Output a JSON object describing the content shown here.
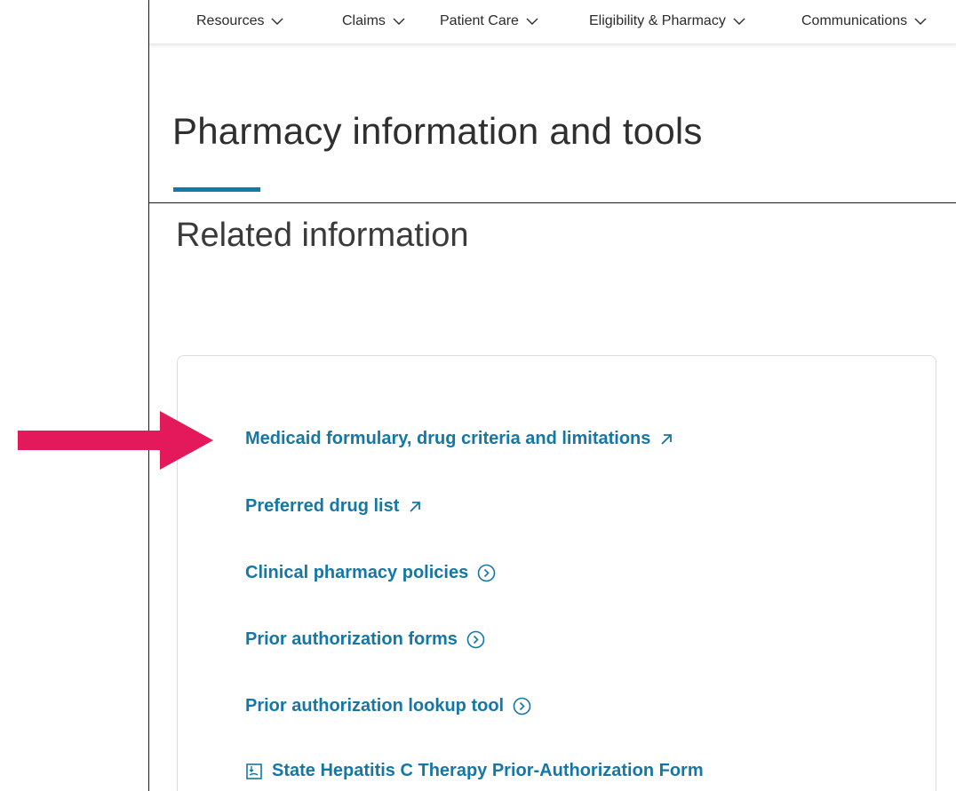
{
  "nav": {
    "items": [
      {
        "label": "Resources"
      },
      {
        "label": "Claims"
      },
      {
        "label": "Patient Care"
      },
      {
        "label": "Eligibility & Pharmacy"
      },
      {
        "label": "Communications"
      }
    ]
  },
  "page": {
    "title": "Pharmacy information and tools"
  },
  "related": {
    "heading": "Related information",
    "links": [
      {
        "label": "Medicaid formulary, drug criteria and limitations",
        "icon": "external-link-icon"
      },
      {
        "label": "Preferred drug list",
        "icon": "external-link-icon"
      },
      {
        "label": "Clinical pharmacy policies",
        "icon": "chevron-circle-right-icon"
      },
      {
        "label": "Prior authorization forms",
        "icon": "chevron-circle-right-icon"
      },
      {
        "label": "Prior authorization lookup tool",
        "icon": "chevron-circle-right-icon"
      },
      {
        "label": "State Hepatitis C Therapy Prior-Authorization Form",
        "icon": "pdf-icon"
      }
    ]
  },
  "colors": {
    "link": "#1577a6",
    "accent_underline": "#1479a8",
    "annotation_arrow": "#e3195b"
  }
}
